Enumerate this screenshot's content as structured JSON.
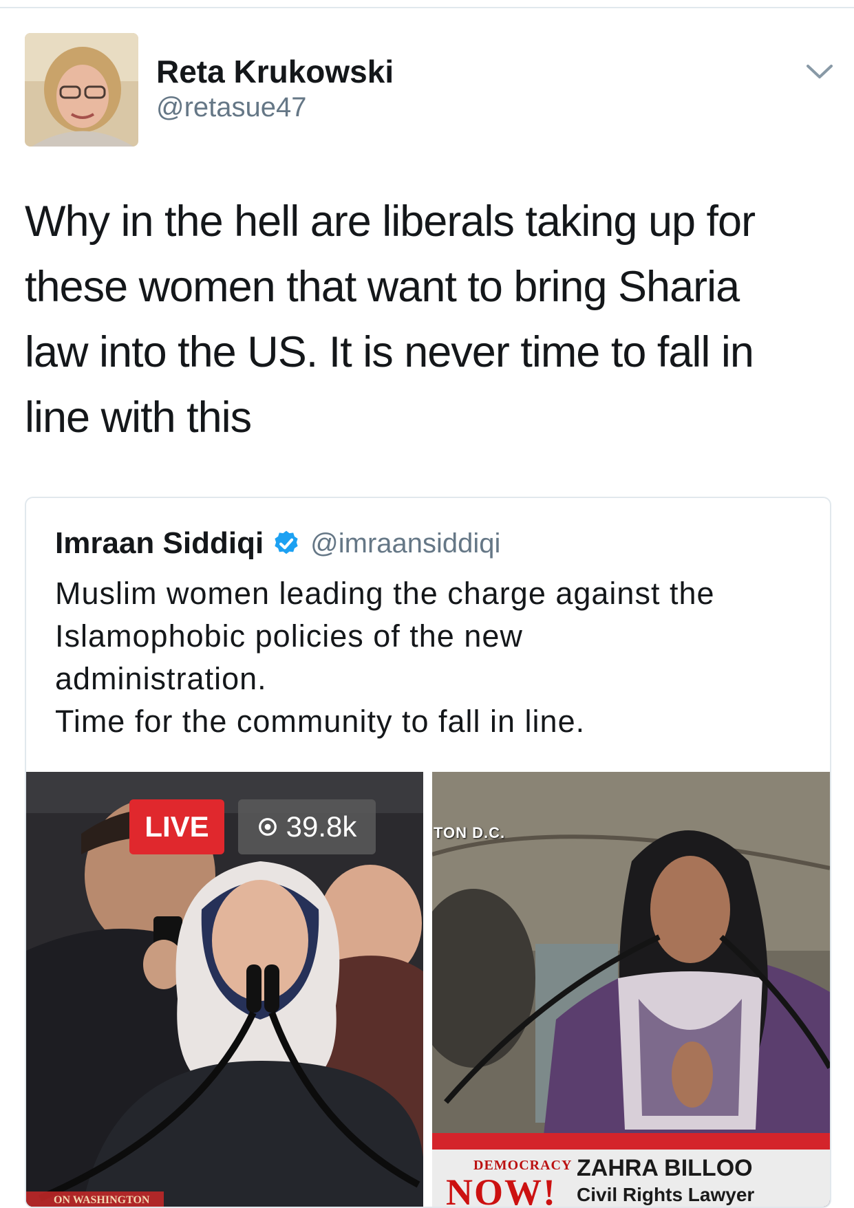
{
  "tweet": {
    "author_name": "Reta Krukowski",
    "author_handle": "@retasue47",
    "text": "Why in the hell are liberals taking up for\nthese women that want to bring Sharia\nlaw into the US. It is never time to fall in\nline with this"
  },
  "quoted_tweet": {
    "author_name": "Imraan Siddiqi",
    "author_handle": "@imraansiddiqi",
    "verified": true,
    "text": "Muslim women leading the charge against the\nIslamophobic policies of the new\nadministration.\nTime for the community to fall in line.",
    "media": [
      {
        "live_label": "LIVE",
        "view_count": "39.8k",
        "location_overlay": "ON WASHINGTON"
      },
      {
        "location_overlay": "TON D.C.",
        "show_logo_top": "DEMOCRACY",
        "show_logo_bottom": "NOW!",
        "guest_name": "ZAHRA BILLOO",
        "guest_title": "Civil Rights Lawyer"
      }
    ]
  },
  "colors": {
    "link_gray": "#657786",
    "verified_blue": "#1da1f2",
    "live_red": "#e0282d",
    "border": "#e1e8ed"
  },
  "icons": [
    "chevron-down-icon",
    "verified-badge-icon",
    "eye-icon"
  ]
}
